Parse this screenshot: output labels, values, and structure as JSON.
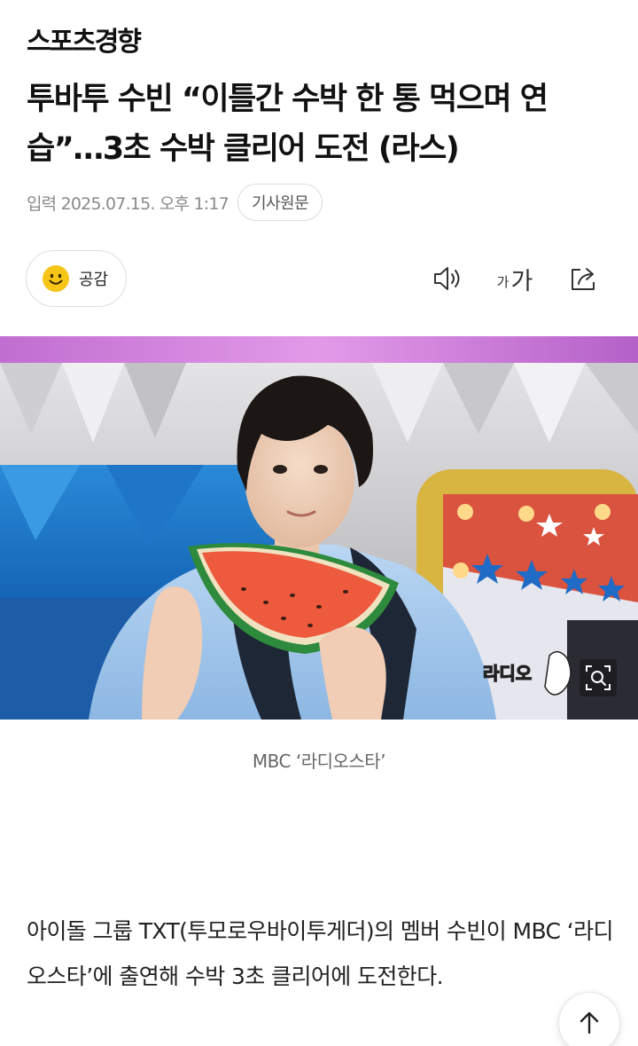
{
  "header": {
    "logo_text": "스포츠경향"
  },
  "article": {
    "title": "투바투 수빈 “이틀간 수박 한 통 먹으며 연습”…3초 수박 클리어 도전 (라스)",
    "meta": {
      "published": "입력 2025.07.15. 오후 1:17",
      "origin_button": "기사원문"
    },
    "empathy_label": "공감",
    "toolbar": {
      "font_small": "가",
      "font_large": "가"
    },
    "photo": {
      "watermark": "라디오",
      "zoom_icon": "zoom-search-icon"
    },
    "caption": "MBC ‘라디오스타’",
    "body": "아이돌 그룹 TXT(투모로우바이투게더)의 멤버 수빈이 MBC ‘라디오스타’에 출연해 수박 3초 클리어에 도전한다."
  },
  "icons": {
    "empathy": "smiley-face-icon",
    "audio": "speaker-icon",
    "font": "font-size-icon",
    "share": "share-icon",
    "scroll_top": "arrow-up-icon"
  },
  "colors": {
    "smiley": "#F5C518",
    "text": "#111111",
    "meta": "#8A8A8A"
  }
}
